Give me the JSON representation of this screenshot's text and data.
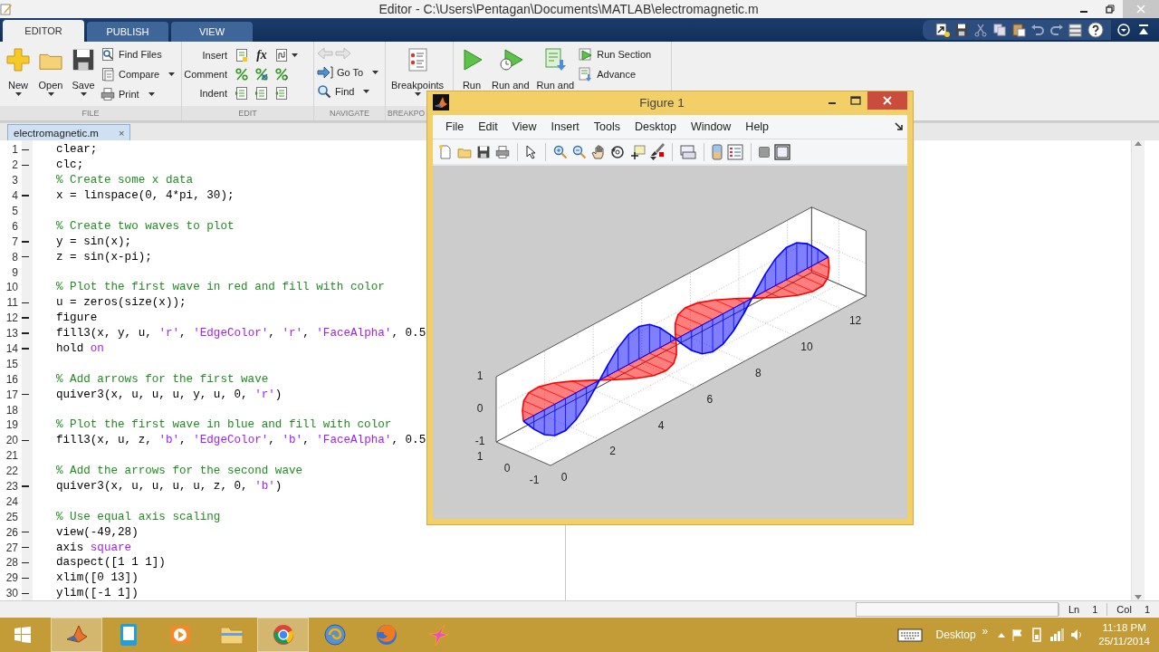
{
  "window": {
    "title": "Editor - C:\\Users\\Pentagan\\Documents\\MATLAB\\electromagnetic.m"
  },
  "tabs": [
    {
      "label": "EDITOR",
      "selected": true
    },
    {
      "label": "PUBLISH",
      "selected": false
    },
    {
      "label": "VIEW",
      "selected": false
    }
  ],
  "ribbon": [
    {
      "kind": "file",
      "label": "FILE",
      "large": [
        {
          "label": "New",
          "dropdown": true
        },
        {
          "label": "Open",
          "dropdown": true
        },
        {
          "label": "Save",
          "dropdown": true
        }
      ],
      "small": [
        {
          "label": "Find Files",
          "dropdown": false
        },
        {
          "label": "Compare",
          "dropdown": true
        },
        {
          "label": "Print",
          "dropdown": true
        }
      ]
    },
    {
      "kind": "edit",
      "label": "EDIT",
      "fx_glyph": "fx",
      "rows": [
        {
          "label": "Insert",
          "dropdown": true
        },
        {
          "label": "Comment",
          "dropdown": false
        },
        {
          "label": "Indent",
          "dropdown": false
        }
      ]
    },
    {
      "kind": "navigate",
      "label": "NAVIGATE",
      "small": [
        {
          "label": "Go To",
          "dropdown": true
        },
        {
          "label": "Find",
          "dropdown": true
        }
      ]
    },
    {
      "kind": "breakpoints",
      "label": "BREAKPO",
      "large": [
        {
          "label": "Breakpoints",
          "dropdown": true
        }
      ]
    },
    {
      "kind": "run",
      "large": [
        {
          "label": "Run",
          "dropdown": false
        },
        {
          "label": "Run and",
          "dropdown": false
        },
        {
          "label": "Run and",
          "dropdown": false
        }
      ],
      "small": [
        {
          "label": "Run Section",
          "dropdown": false
        },
        {
          "label": "Advance",
          "dropdown": false
        }
      ]
    }
  ],
  "document_tab": {
    "label": "electromagnetic.m",
    "close": "×",
    "selected": true
  },
  "lines": [
    {
      "number": "1",
      "executable": true,
      "segments": [
        {
          "kind": "code",
          "text": "clear;"
        }
      ]
    },
    {
      "number": "2",
      "executable": true,
      "segments": [
        {
          "kind": "code",
          "text": "clc;"
        }
      ]
    },
    {
      "number": "3",
      "executable": false,
      "segments": [
        {
          "kind": "comment",
          "text": "% Create some x data"
        }
      ]
    },
    {
      "number": "4",
      "executable": true,
      "segments": [
        {
          "kind": "code",
          "text": "x = linspace(0, 4*pi, 30);"
        }
      ]
    },
    {
      "number": "5",
      "executable": false
    },
    {
      "number": "6",
      "executable": false,
      "segments": [
        {
          "kind": "comment",
          "text": "% Create two waves to plot"
        }
      ]
    },
    {
      "number": "7",
      "executable": true,
      "segments": [
        {
          "kind": "code",
          "text": "y = sin(x);"
        }
      ]
    },
    {
      "number": "8",
      "executable": true,
      "segments": [
        {
          "kind": "code",
          "text": "z = sin(x-pi);"
        }
      ]
    },
    {
      "number": "9",
      "executable": false
    },
    {
      "number": "10",
      "executable": false,
      "segments": [
        {
          "kind": "comment",
          "text": "% Plot the first wave in red and fill with color"
        }
      ]
    },
    {
      "number": "11",
      "executable": true,
      "segments": [
        {
          "kind": "code",
          "text": "u = zeros(size(x));"
        }
      ]
    },
    {
      "number": "12",
      "executable": true,
      "segments": [
        {
          "kind": "code",
          "text": "figure"
        }
      ]
    },
    {
      "number": "13",
      "executable": true,
      "segments": [
        {
          "kind": "code",
          "text": "fill3(x, y, u, "
        },
        {
          "kind": "string",
          "text": "'r'"
        },
        {
          "kind": "code",
          "text": ", "
        },
        {
          "kind": "string",
          "text": "'EdgeColor'"
        },
        {
          "kind": "code",
          "text": ", "
        },
        {
          "kind": "string",
          "text": "'r'"
        },
        {
          "kind": "code",
          "text": ", "
        },
        {
          "kind": "string",
          "text": "'FaceAlpha'"
        },
        {
          "kind": "code",
          "text": ", 0.5"
        }
      ]
    },
    {
      "number": "14",
      "executable": true,
      "segments": [
        {
          "kind": "code",
          "text": "hold "
        },
        {
          "kind": "string",
          "text": "on"
        }
      ]
    },
    {
      "number": "15",
      "executable": false
    },
    {
      "number": "16",
      "executable": false,
      "segments": [
        {
          "kind": "comment",
          "text": "% Add arrows for the first wave"
        }
      ]
    },
    {
      "number": "17",
      "executable": true,
      "segments": [
        {
          "kind": "code",
          "text": "quiver3(x, u, u, u, y, u, 0, "
        },
        {
          "kind": "string",
          "text": "'r'"
        },
        {
          "kind": "code",
          "text": ")"
        }
      ]
    },
    {
      "number": "18",
      "executable": false
    },
    {
      "number": "19",
      "executable": false,
      "segments": [
        {
          "kind": "comment",
          "text": "% Plot the first wave in blue and fill with color"
        }
      ]
    },
    {
      "number": "20",
      "executable": true,
      "segments": [
        {
          "kind": "code",
          "text": "fill3(x, u, z, "
        },
        {
          "kind": "string",
          "text": "'b'"
        },
        {
          "kind": "code",
          "text": ", "
        },
        {
          "kind": "string",
          "text": "'EdgeColor'"
        },
        {
          "kind": "code",
          "text": ", "
        },
        {
          "kind": "string",
          "text": "'b'"
        },
        {
          "kind": "code",
          "text": ", "
        },
        {
          "kind": "string",
          "text": "'FaceAlpha'"
        },
        {
          "kind": "code",
          "text": ", 0.5"
        }
      ]
    },
    {
      "number": "21",
      "executable": false
    },
    {
      "number": "22",
      "executable": false,
      "segments": [
        {
          "kind": "comment",
          "text": "% Add the arrows for the second wave"
        }
      ]
    },
    {
      "number": "23",
      "executable": true,
      "segments": [
        {
          "kind": "code",
          "text": "quiver3(x, u, u, u, u, z, 0, "
        },
        {
          "kind": "string",
          "text": "'b'"
        },
        {
          "kind": "code",
          "text": ")"
        }
      ]
    },
    {
      "number": "24",
      "executable": false
    },
    {
      "number": "25",
      "executable": false,
      "segments": [
        {
          "kind": "comment",
          "text": "% Use equal axis scaling"
        }
      ]
    },
    {
      "number": "26",
      "executable": true,
      "segments": [
        {
          "kind": "code",
          "text": "view(-49,28)"
        }
      ]
    },
    {
      "number": "27",
      "executable": true,
      "segments": [
        {
          "kind": "code",
          "text": "axis "
        },
        {
          "kind": "string",
          "text": "square"
        }
      ]
    },
    {
      "number": "28",
      "executable": true,
      "segments": [
        {
          "kind": "code",
          "text": "daspect([1 1 1])"
        }
      ]
    },
    {
      "number": "29",
      "executable": true,
      "segments": [
        {
          "kind": "code",
          "text": "xlim([0 13])"
        }
      ]
    },
    {
      "number": "30",
      "executable": true,
      "segments": [
        {
          "kind": "code",
          "text": "ylim([-1 1])"
        }
      ]
    }
  ],
  "status_bar": {
    "line_label": "Ln",
    "line": "1",
    "column_label": "Col",
    "column": "1"
  },
  "figure": {
    "title": "Figure 1",
    "menu": [
      "File",
      "Edit",
      "View",
      "Insert",
      "Tools",
      "Desktop",
      "Window",
      "Help"
    ],
    "plot": {
      "x_ticks": [
        "0",
        "2",
        "4",
        "6",
        "8",
        "10",
        "12"
      ],
      "y_ticks": [
        "1",
        "0",
        "-1"
      ],
      "z_ticks": [
        "1",
        "0",
        "-1"
      ],
      "waves": [
        {
          "kind": "horizontal",
          "color": "#ff0000"
        },
        {
          "kind": "vertical",
          "color": "#0000ff"
        }
      ]
    }
  },
  "taskbar": {
    "apps": [
      {
        "active": true
      },
      {
        "active": false
      },
      {
        "active": false
      },
      {
        "active": false
      },
      {
        "active": true
      },
      {
        "active": false
      },
      {
        "active": false
      },
      {
        "active": false
      }
    ],
    "tray_label": "Desktop",
    "tray_expand": "»",
    "time": "11:18 PM",
    "date": "25/11/2014"
  }
}
